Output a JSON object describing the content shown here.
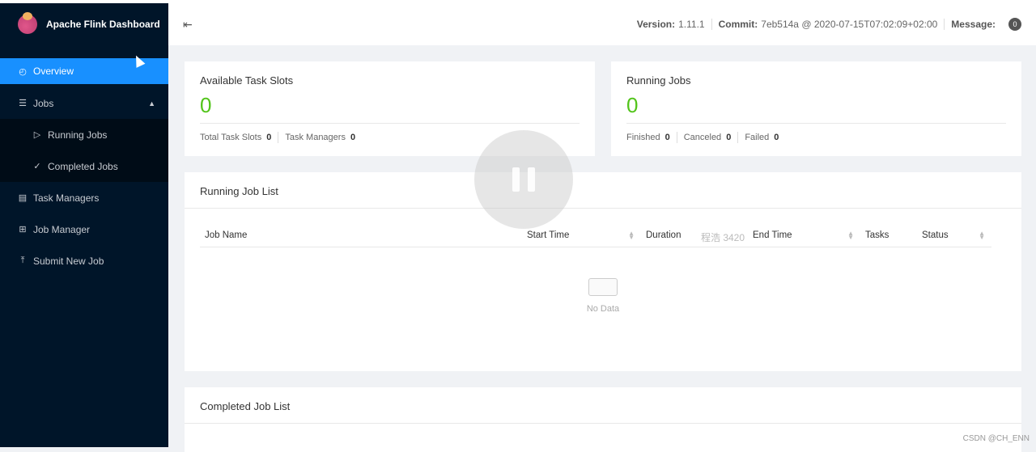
{
  "sidebar": {
    "title": "Apache Flink Dashboard",
    "items": [
      {
        "label": "Overview"
      },
      {
        "label": "Jobs"
      },
      {
        "label": "Running Jobs"
      },
      {
        "label": "Completed Jobs"
      },
      {
        "label": "Task Managers"
      },
      {
        "label": "Job Manager"
      },
      {
        "label": "Submit New Job"
      }
    ]
  },
  "header": {
    "version_label": "Version:",
    "version": "1.11.1",
    "commit_label": "Commit:",
    "commit": "7eb514a @ 2020-07-15T07:02:09+02:00",
    "message_label": "Message:",
    "message_count": "0"
  },
  "slots": {
    "title": "Available Task Slots",
    "value": "0",
    "total_label": "Total Task Slots",
    "total": "0",
    "tm_label": "Task Managers",
    "tm": "0"
  },
  "running": {
    "title": "Running Jobs",
    "value": "0",
    "finished_label": "Finished",
    "finished": "0",
    "canceled_label": "Canceled",
    "canceled": "0",
    "failed_label": "Failed",
    "failed": "0"
  },
  "running_list": {
    "title": "Running Job List",
    "columns": [
      "Job Name",
      "Start Time",
      "Duration",
      "End Time",
      "Tasks",
      "Status"
    ],
    "empty": "No Data"
  },
  "completed_list": {
    "title": "Completed Job List"
  },
  "watermark": "程浩 3420",
  "credit": "CSDN @CH_ENN"
}
